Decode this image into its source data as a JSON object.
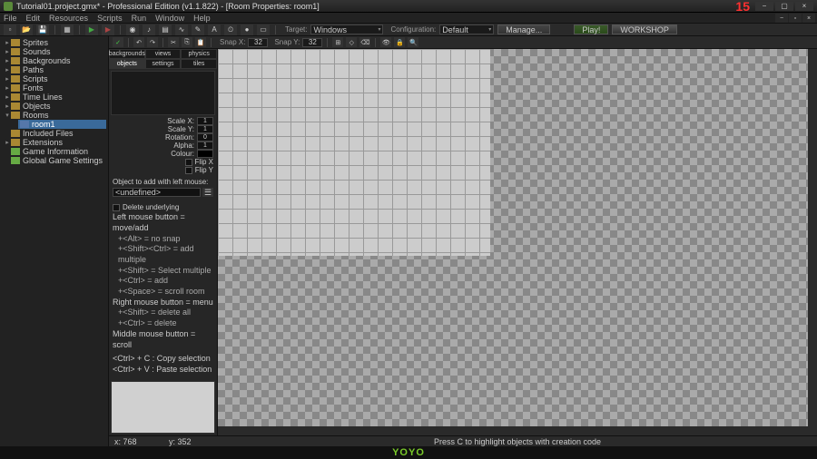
{
  "title": "Tutorial01.project.gmx* - Professional Edition (v1.1.822) - [Room Properties: room1]",
  "fps": "15",
  "menu": [
    "File",
    "Edit",
    "Resources",
    "Scripts",
    "Run",
    "Window",
    "Help"
  ],
  "toolbar": {
    "target_label": "Target:",
    "target_value": "Windows",
    "config_label": "Configuration:",
    "config_value": "Default",
    "manage": "Manage...",
    "play": "Play!",
    "workshop": "WORKSHOP"
  },
  "tree": {
    "items": [
      "Sprites",
      "Sounds",
      "Backgrounds",
      "Paths",
      "Scripts",
      "Fonts",
      "Time Lines",
      "Objects",
      "Rooms",
      "Included Files",
      "Extensions",
      "Game Information",
      "Global Game Settings"
    ],
    "rooms_expanded": true,
    "room_child": "room1"
  },
  "roomtoolbar": {
    "snapx_label": "Snap X:",
    "snapx": "32",
    "snapy_label": "Snap Y:",
    "snapy": "32"
  },
  "tabs": {
    "backgrounds": "backgrounds",
    "views": "views",
    "physics": "physics",
    "objects": "objects",
    "settings": "settings",
    "tiles": "tiles"
  },
  "props": {
    "scalex_label": "Scale X:",
    "scalex": "1",
    "scaley_label": "Scale Y:",
    "scaley": "1",
    "rotation_label": "Rotation:",
    "rotation": "0",
    "alpha_label": "Alpha:",
    "alpha": "1",
    "colour_label": "Colour:",
    "flipx": "Flip X",
    "flipy": "Flip Y"
  },
  "obj": {
    "label": "Object to add with left mouse:",
    "value": "<undefined>",
    "del_underlying": "Delete underlying"
  },
  "hints": {
    "l1": "Left mouse button = move/add",
    "l1a": "+<Alt> = no snap",
    "l1b": "+<Shift><Ctrl> = add multiple",
    "l1c": "+<Shift> = Select multiple",
    "l1d": "+<Ctrl> = add",
    "l1e": "+<Space> = scroll room",
    "l2": "Right mouse button = menu",
    "l2a": "+<Shift> = delete all",
    "l2b": "+<Ctrl> = delete",
    "l3": "Middle mouse button = scroll",
    "c1": "<Ctrl> + C : Copy selection",
    "c2": "<Ctrl> + V : Paste selection"
  },
  "status": {
    "x": "x: 768",
    "y": "y: 352",
    "msg": "Press C to highlight objects with creation code"
  },
  "logo": "YOYO"
}
